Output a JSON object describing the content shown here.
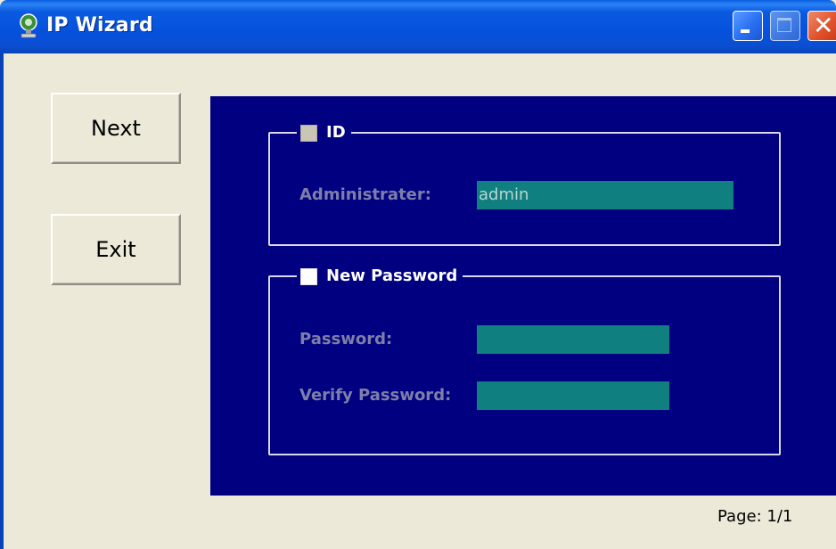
{
  "window": {
    "title": "IP Wizard",
    "icon": "ip-wizard-app-icon",
    "controls": {
      "minimize": "minimize-icon",
      "maximize": "maximize-icon",
      "close": "close-icon"
    }
  },
  "sidebar": {
    "next_label": "Next",
    "exit_label": "Exit"
  },
  "id_group": {
    "legend": "ID",
    "checked": false,
    "enabled": false,
    "administrator_label": "Administrater:",
    "administrator_value": "admin"
  },
  "password_group": {
    "legend": "New Password",
    "checked": false,
    "password_label": "Password:",
    "password_value": "",
    "verify_label": "Verify Password:",
    "verify_value": ""
  },
  "footer": {
    "page": "Page: 1/1"
  },
  "colors": {
    "panel_background": "#000080",
    "input_background": "#0f7f7f",
    "disabled_label": "#7e7fa8",
    "window_background": "#ece9d8"
  }
}
